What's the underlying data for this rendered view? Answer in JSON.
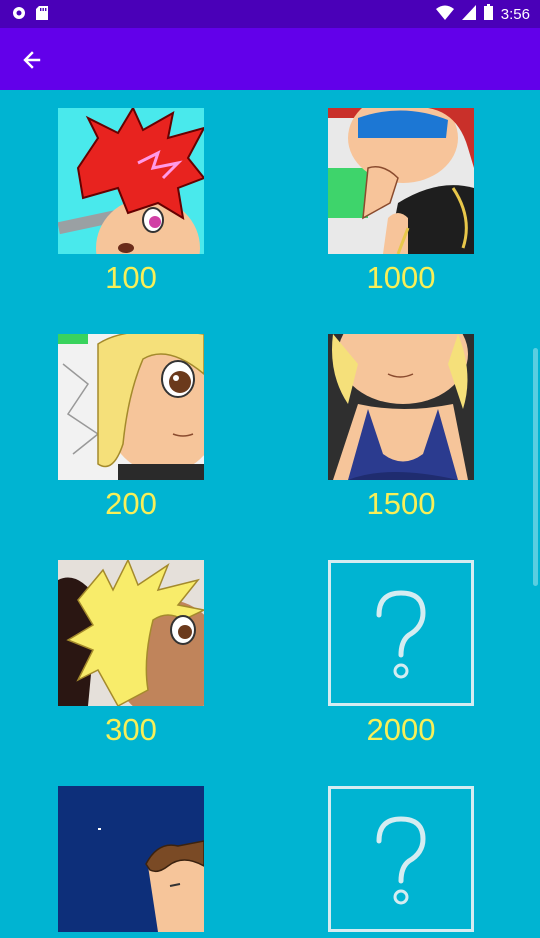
{
  "status_bar": {
    "time": "3:56",
    "icons": [
      "circle-notification-icon",
      "sd-card-icon",
      "wifi-icon",
      "signal-icon",
      "battery-icon"
    ]
  },
  "app_bar": {
    "back_icon": "arrow-left-icon"
  },
  "colors": {
    "status_bar": "#4a00b8",
    "app_bar": "#6200ea",
    "background": "#00b4d2",
    "label": "#f7ef58",
    "locked_border": "#d5ecf1"
  },
  "gallery": {
    "left": [
      {
        "label": "100",
        "state": "unlocked",
        "art": "red-spiky-hair-character"
      },
      {
        "label": "200",
        "state": "unlocked",
        "art": "blonde-character-closeup"
      },
      {
        "label": "300",
        "state": "unlocked",
        "art": "spiky-blonde-tan-character"
      },
      {
        "label": "",
        "state": "unlocked",
        "art": "night-sky-character"
      }
    ],
    "right": [
      {
        "label": "1000",
        "state": "unlocked",
        "art": "goggles-thinking-character"
      },
      {
        "label": "1500",
        "state": "unlocked",
        "art": "blonde-swimsuit-character"
      },
      {
        "label": "2000",
        "state": "locked",
        "art": "question-mark-icon"
      },
      {
        "label": "",
        "state": "locked",
        "art": "question-mark-icon"
      }
    ]
  }
}
